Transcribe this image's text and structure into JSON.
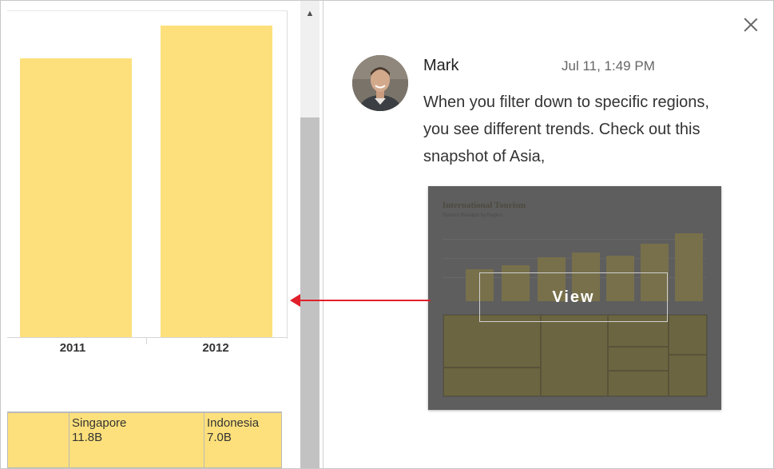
{
  "chart": {
    "x_labels": [
      "2011",
      "2012"
    ]
  },
  "treemap": {
    "cells": [
      {
        "country": "",
        "value": ""
      },
      {
        "country": "Singapore",
        "value": "11.8B"
      },
      {
        "country": "Indonesia",
        "value": "7.0B"
      }
    ]
  },
  "comment_panel": {
    "author": "Mark",
    "timestamp": "Jul 11, 1:49 PM",
    "text": "When you filter down to specific regions, you see different trends. Check out this snapshot of Asia,",
    "snapshot": {
      "view_label": "View"
    },
    "close_icon": "close-icon",
    "avatar": "avatar"
  },
  "colors": {
    "bar_fill": "#fde07b",
    "arrow": "#e0202a",
    "snapshot_overlay": "#5e5e5e"
  }
}
